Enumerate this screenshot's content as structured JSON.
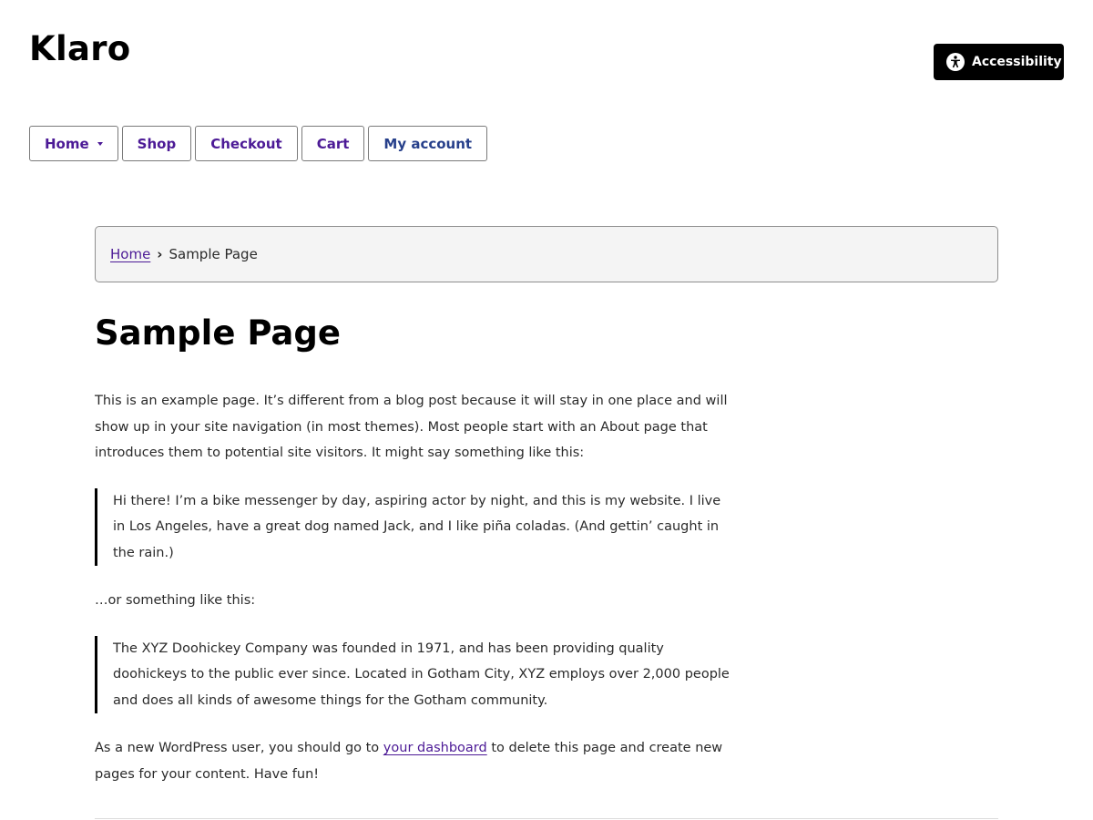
{
  "site": {
    "title": "Klaro"
  },
  "accessibility_button": {
    "label": "Accessibility",
    "icon": "accessibility-person-icon"
  },
  "nav": {
    "items": [
      {
        "label": "Home",
        "has_submenu": true
      },
      {
        "label": "Shop"
      },
      {
        "label": "Checkout"
      },
      {
        "label": "Cart"
      },
      {
        "label": "My account"
      }
    ]
  },
  "breadcrumb": {
    "home": "Home",
    "separator": "›",
    "current": "Sample Page"
  },
  "page": {
    "title": "Sample Page",
    "intro": "This is an example page. It’s different from a blog post because it will stay in one place and will show up in your site navigation (in most themes). Most people start with an About page that introduces them to potential site visitors. It might say something like this:",
    "quote1": "Hi there! I’m a bike messenger by day, aspiring actor by night, and this is my website. I live in Los Angeles, have a great dog named Jack, and I like piña coladas. (And gettin’ caught in the rain.)",
    "or_text": "…or something like this:",
    "quote2": "The XYZ Doohickey Company was founded in 1971, and has been providing quality doohickeys to the public ever since. Located in Gotham City, XYZ employs over 2,000 people and does all kinds of awesome things for the Gotham community.",
    "closing_before": "As a new WordPress user, you should go to ",
    "closing_link": "your dashboard",
    "closing_after": " to delete this page and create new pages for your content. Have fun!"
  },
  "colors": {
    "link": "#4c1a96",
    "account_link": "#27408b",
    "button_bg": "#000000",
    "breadcrumb_bg": "#f4f4f4"
  }
}
